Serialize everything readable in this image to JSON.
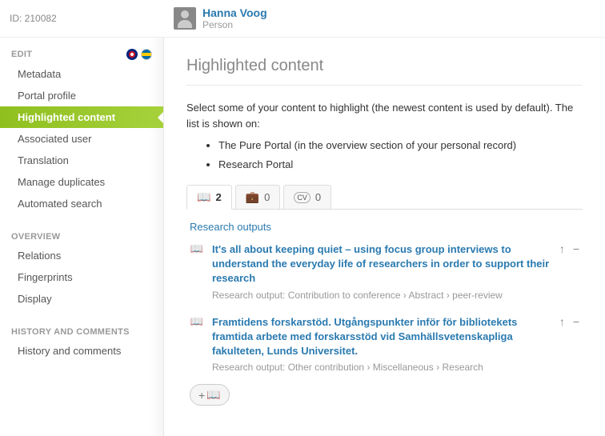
{
  "header": {
    "id_label": "ID: 210082",
    "name": "Hanna Voog",
    "type": "Person"
  },
  "sidebar": {
    "edit_label": "EDIT",
    "edit_items": [
      "Metadata",
      "Portal profile",
      "Highlighted content",
      "Associated user",
      "Translation",
      "Manage duplicates",
      "Automated search"
    ],
    "overview_label": "OVERVIEW",
    "overview_items": [
      "Relations",
      "Fingerprints",
      "Display"
    ],
    "history_label": "HISTORY AND COMMENTS",
    "history_items": [
      "History and comments"
    ]
  },
  "main": {
    "title": "Highlighted content",
    "intro": "Select some of your content to highlight (the newest content is used by default). The list is shown on:",
    "bullets": [
      "The Pure Portal (in the overview section of your personal record)",
      "Research Portal"
    ],
    "tabs": [
      {
        "count": "2"
      },
      {
        "count": "0"
      },
      {
        "count": "0",
        "label": "CV"
      }
    ],
    "subheader": "Research outputs",
    "outputs": [
      {
        "title": "It's all about keeping quiet – using focus group interviews to understand the everyday life of researchers in order to support their research",
        "meta": "Research output: Contribution to conference › Abstract › peer-review"
      },
      {
        "title": "Framtidens forskarstöd. Utgångspunkter inför för bibliotekets framtida arbete med forskarsstöd vid Samhällsvetenskapliga fakulteten, Lunds Universitet.",
        "meta": "Research output: Other contribution › Miscellaneous › Research"
      }
    ]
  }
}
